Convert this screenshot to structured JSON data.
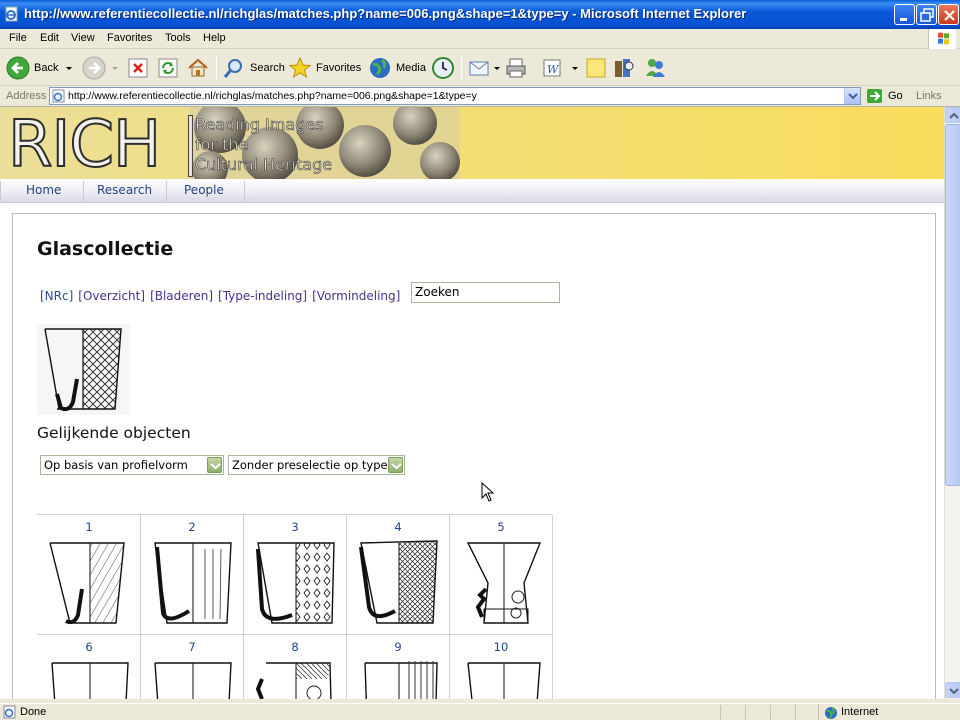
{
  "window": {
    "title": "http://www.referentiecollectie.nl/richglas/matches.php?name=006.png&shape=1&type=y - Microsoft Internet Explorer"
  },
  "menu": [
    "File",
    "Edit",
    "View",
    "Favorites",
    "Tools",
    "Help"
  ],
  "toolbar": {
    "back": "Back",
    "search": "Search",
    "favorites": "Favorites",
    "media": "Media"
  },
  "address": {
    "label": "Address",
    "url": "http://www.referentiecollectie.nl/richglas/matches.php?name=006.png&shape=1&type=y",
    "go": "Go",
    "links": "Links"
  },
  "banner": {
    "logo": "RICH",
    "tagline_1": "Reading Images",
    "tagline_2": "for the",
    "tagline_3": "Cultural Heritage"
  },
  "nav": [
    "Home",
    "Research",
    "People"
  ],
  "page": {
    "title": "Glascollectie",
    "links": [
      "[NRc]",
      "[Overzicht]",
      "[Bladeren]",
      "[Type-indeling]",
      "[Vormindeling]"
    ],
    "search_value": "Zoeken",
    "similar_title": "Gelijkende objecten",
    "select_shape": "Op basis van profielvorm",
    "select_type": "Zonder preselectie op type"
  },
  "results": {
    "row1": [
      "1",
      "2",
      "3",
      "4",
      "5"
    ],
    "row2": [
      "6",
      "7",
      "8",
      "9",
      "10"
    ]
  },
  "status": {
    "text": "Done",
    "zone": "Internet"
  }
}
